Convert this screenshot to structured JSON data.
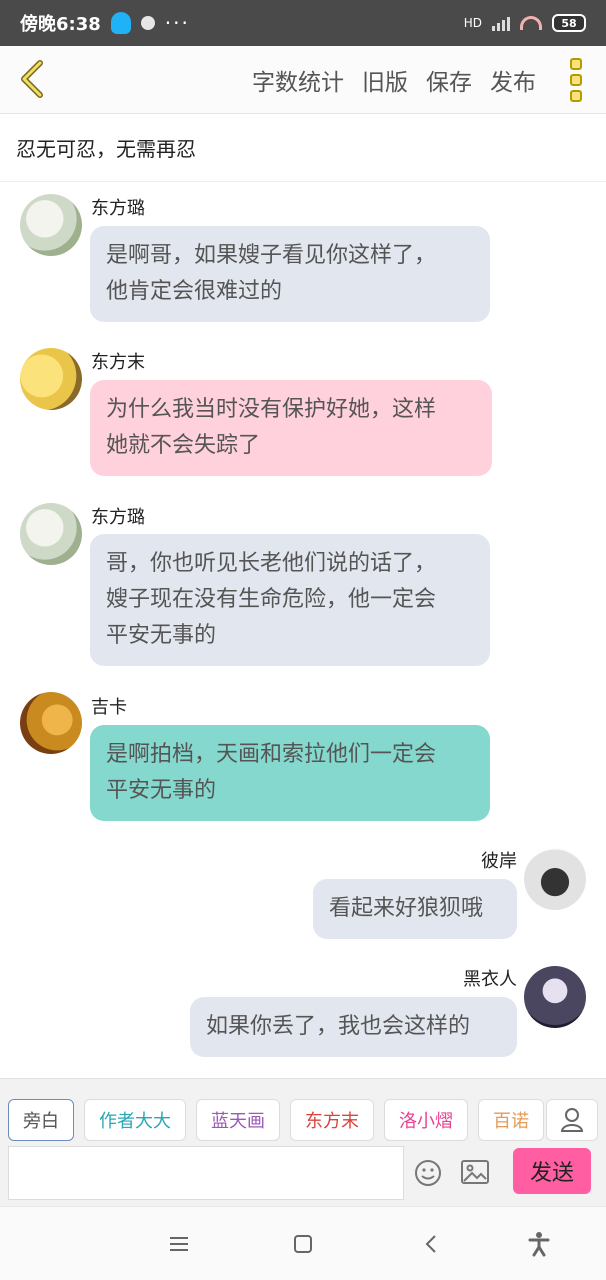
{
  "status_bar": {
    "time": "傍晚6:38",
    "battery": "58",
    "network": "HD"
  },
  "header": {
    "actions": [
      "字数统计",
      "旧版",
      "保存",
      "发布"
    ]
  },
  "title": "忍无可忍，无需再忍",
  "messages": [
    {
      "name": "东方璐",
      "text_lines": [
        "是啊哥，如果嫂子看见你这样了，",
        "他肯定会很难过的"
      ],
      "side": "left",
      "color": "gray",
      "avatar_color": "#cfd9c7"
    },
    {
      "name": "东方末",
      "text_lines": [
        "为什么我当时没有保护好她，这样",
        "她就不会失踪了"
      ],
      "side": "left",
      "color": "pink",
      "avatar_color": "#e9c64a"
    },
    {
      "name": "东方璐",
      "text_lines": [
        "哥，你也听见长老他们说的话了，",
        "嫂子现在没有生命危险，他一定会",
        "平安无事的"
      ],
      "side": "left",
      "color": "gray",
      "avatar_color": "#cfd9c7"
    },
    {
      "name": "吉卡",
      "text_lines": [
        "是啊拍档，天画和索拉他们一定会",
        "平安无事的"
      ],
      "side": "left",
      "color": "teal",
      "avatar_color": "#c98a1f"
    },
    {
      "name": "彼岸",
      "text_lines": [
        "看起来好狼狈哦"
      ],
      "side": "right",
      "color": "gray",
      "avatar_color": "#e2e2e2"
    },
    {
      "name": "黑衣人",
      "text_lines": [
        "如果你丢了，我也会这样的"
      ],
      "side": "right",
      "color": "gray",
      "avatar_color": "#4b4660"
    }
  ],
  "composer": {
    "chips": [
      {
        "label": "旁白",
        "color": "#555555"
      },
      {
        "label": "作者大大",
        "color": "#2aa6b5"
      },
      {
        "label": "蓝天画",
        "color": "#9b59b6"
      },
      {
        "label": "东方末",
        "color": "#d9443c"
      },
      {
        "label": "洛小熠",
        "color": "#e84393"
      },
      {
        "label": "百诺",
        "color": "#e59b55"
      }
    ],
    "input_placeholder": "",
    "send_label": "发送"
  },
  "colors": {
    "accent_pink": "#ff5fa2",
    "bubble_gray": "#e2e7ef",
    "bubble_pink": "#ffd1dc",
    "bubble_teal": "#85d8cd"
  }
}
